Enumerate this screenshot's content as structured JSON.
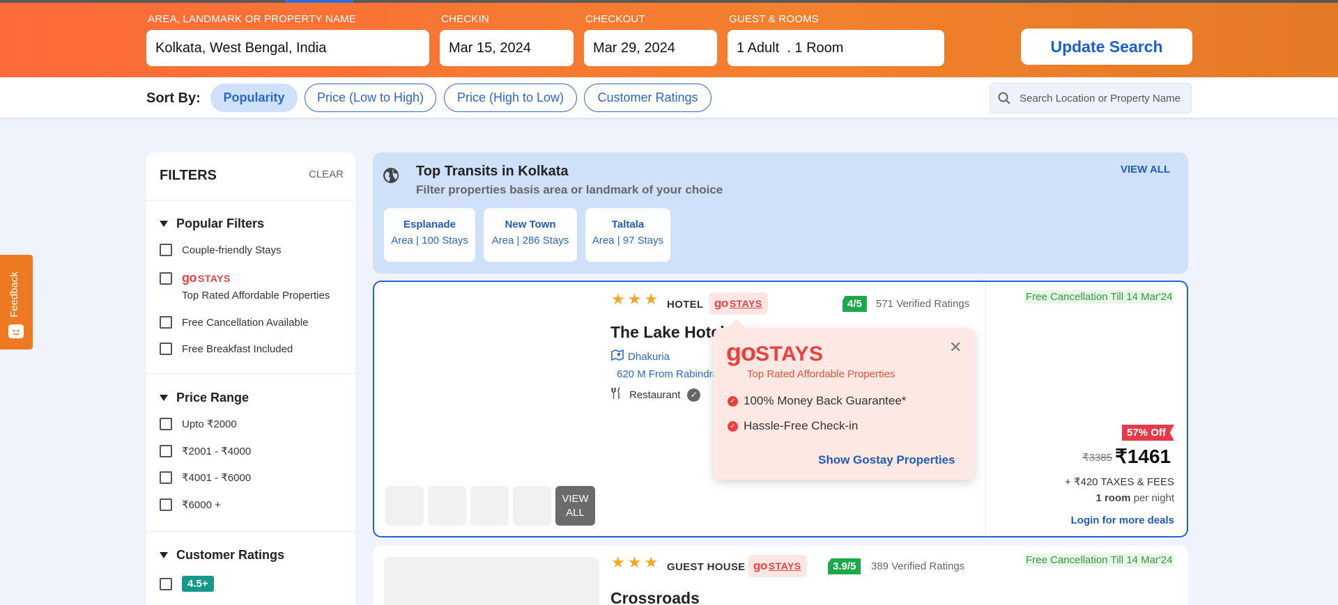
{
  "search": {
    "location_label": "AREA, LANDMARK OR PROPERTY NAME",
    "location_value": "Kolkata, West Bengal, India",
    "checkin_label": "CHECKIN",
    "checkin_value": "Mar 15, 2024",
    "checkout_label": "CHECKOUT",
    "checkout_value": "Mar 29, 2024",
    "guests_label": "GUEST & ROOMS",
    "guests_value": "1 Adult  . 1 Room",
    "update_label": "Update Search"
  },
  "sort": {
    "label": "Sort By:",
    "options": [
      "Popularity",
      "Price (Low to High)",
      "Price (High to Low)",
      "Customer Ratings"
    ],
    "active": "Popularity",
    "search_placeholder": "Search Location or Property Name"
  },
  "feedback": {
    "label": "Feedback"
  },
  "filters": {
    "title": "FILTERS",
    "clear": "CLEAR",
    "popular": {
      "title": "Popular Filters",
      "items": [
        "Couple-friendly Stays",
        "Top Rated Affordable Properties",
        "Free Cancellation Available",
        "Free Breakfast Included"
      ]
    },
    "price": {
      "title": "Price Range",
      "items": [
        "Upto ₹2000",
        "₹2001 - ₹4000",
        "₹4001 - ₹6000",
        "₹6000 +"
      ]
    },
    "ratings": {
      "title": "Customer Ratings",
      "items": [
        "4.5+"
      ]
    }
  },
  "gostays": {
    "brand_go": "go",
    "brand_stays": "STAYS"
  },
  "transits": {
    "title": "Top Transits in Kolkata",
    "subtitle": "Filter properties basis area or landmark of your choice",
    "view_all": "VIEW ALL",
    "cards": [
      {
        "name": "Esplanade",
        "count": "Area | 100 Stays"
      },
      {
        "name": "New Town",
        "count": "Area | 286 Stays"
      },
      {
        "name": "Taltala",
        "count": "Area | 97 Stays"
      }
    ]
  },
  "hotels": [
    {
      "type": "HOTEL",
      "score": "4/5",
      "ratings": "571 Verified Ratings",
      "free_cancel": "Free Cancellation Till 14 Mar'24",
      "name": "The Lake Hotel",
      "locality": "Dhakuria",
      "distance": "620 M From Rabindra",
      "amenity": "Restaurant",
      "view_all": "VIEW ALL",
      "discount": "57% Off",
      "old_price": "₹3385",
      "price": "₹1461",
      "taxes": "+ ₹420 TAXES & FEES",
      "per_night_bold": "1 room",
      "per_night_rest": " per night",
      "login_deals": "Login for more deals"
    },
    {
      "type": "GUEST HOUSE",
      "score": "3.9/5",
      "ratings": "389 Verified Ratings",
      "free_cancel": "Free Cancellation Till 14 Mar'24",
      "name": "Crossroads"
    }
  ],
  "popup": {
    "tagline": "Top Rated Affordable Properties",
    "items": [
      "100% Money Back Guarantee*",
      "Hassle-Free Check-in"
    ],
    "cta": "Show Gostay Properties"
  }
}
